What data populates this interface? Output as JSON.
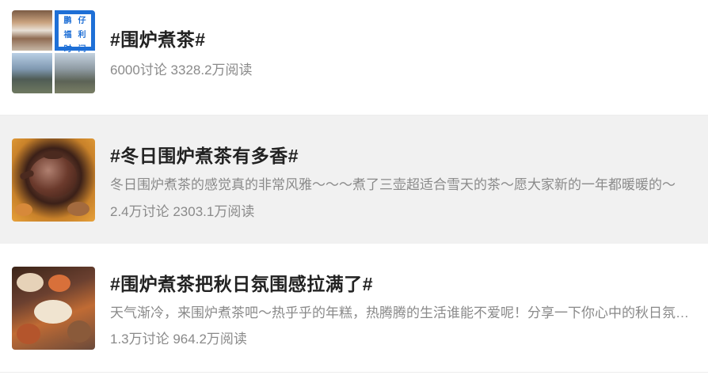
{
  "topics": [
    {
      "title": "#围炉煮茶#",
      "description": "",
      "stats": "6000讨论 3328.2万阅读",
      "thumbnail": {
        "icon": "collage-thumbnail",
        "badge_chars": [
          "鹏",
          "仔",
          "福",
          "利",
          "时",
          "间"
        ]
      }
    },
    {
      "title": "#冬日围炉煮茶有多香#",
      "description": "冬日围炉煮茶的感觉真的非常风雅～～～煮了三壶超适合雪天的茶～愿大家新的一年都暖暖的～",
      "stats": "2.4万讨论 2303.1万阅读",
      "thumbnail": {
        "icon": "teapot-thumbnail"
      }
    },
    {
      "title": "#围炉煮茶把秋日氛围感拉满了#",
      "description": "天气渐冷，来围炉煮茶吧～热乎乎的年糕，热腾腾的生活谁能不爱呢！分享一下你心中的秋日氛围感吧～",
      "stats": "1.3万讨论 964.2万阅读",
      "thumbnail": {
        "icon": "tea-table-thumbnail"
      }
    }
  ],
  "colors": {
    "title": "#222222",
    "meta": "#8a8a8a",
    "highlight_row_bg": "#f1f1f1",
    "badge_blue": "#1e6fd6"
  }
}
